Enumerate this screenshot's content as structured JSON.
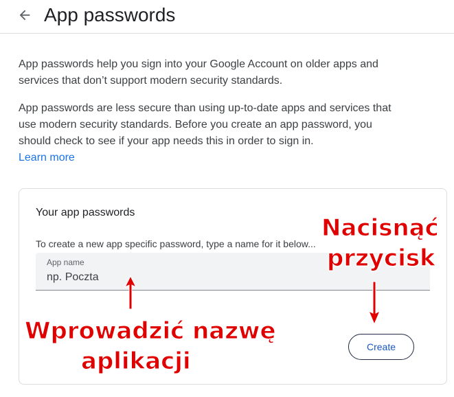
{
  "header": {
    "back_icon": "arrow-left-icon",
    "title": "App passwords"
  },
  "intro": {
    "paragraph_1": "App passwords help you sign into your Google Account on older apps and services that don’t support modern security standards.",
    "paragraph_2": "App passwords are less secure than using up-to-date apps and services that use modern security standards. Before you create an app password, you should check to see if your app needs this in order to sign in.",
    "learn_more": "Learn more"
  },
  "card": {
    "title": "Your app passwords",
    "description": "To create a new app specific password, type a name for it below...",
    "app_name_label": "App name",
    "app_name_value": "np. Poczta",
    "create_label": "Create"
  },
  "annotations": {
    "field_hint_line1": "Wprowadzić nazwę",
    "field_hint_line2": "aplikacji",
    "button_hint_line1": "Nacisnąć",
    "button_hint_line2": "przycisk",
    "color": "#e00000"
  },
  "colors": {
    "link": "#1a73e8",
    "field_bg": "#f1f3f4",
    "divider": "#dadce0"
  }
}
